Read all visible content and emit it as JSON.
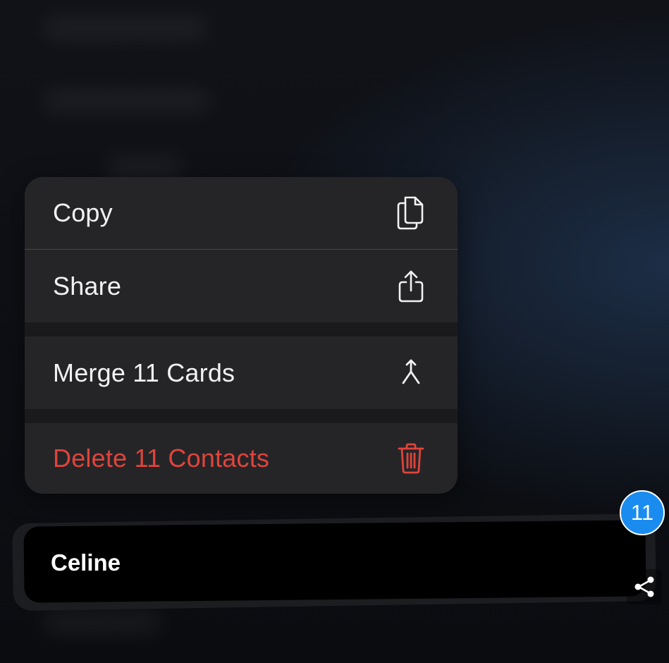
{
  "menu": {
    "items": [
      {
        "label": "Copy",
        "icon": "copy-icon",
        "destructive": false
      },
      {
        "label": "Share",
        "icon": "share-icon",
        "destructive": false
      },
      {
        "label": "Merge 11 Cards",
        "icon": "merge-icon",
        "destructive": false
      },
      {
        "label": "Delete 11 Contacts",
        "icon": "trash-icon",
        "destructive": true
      }
    ]
  },
  "card": {
    "name": "Celine",
    "selection_count": "11"
  },
  "overlay": {
    "icon": "share-nodes-icon"
  },
  "colors": {
    "menu_background": "#252528",
    "text": "#f2f2f4",
    "destructive": "#e0443b",
    "badge": "#1a8cf0",
    "card": "#000000"
  }
}
